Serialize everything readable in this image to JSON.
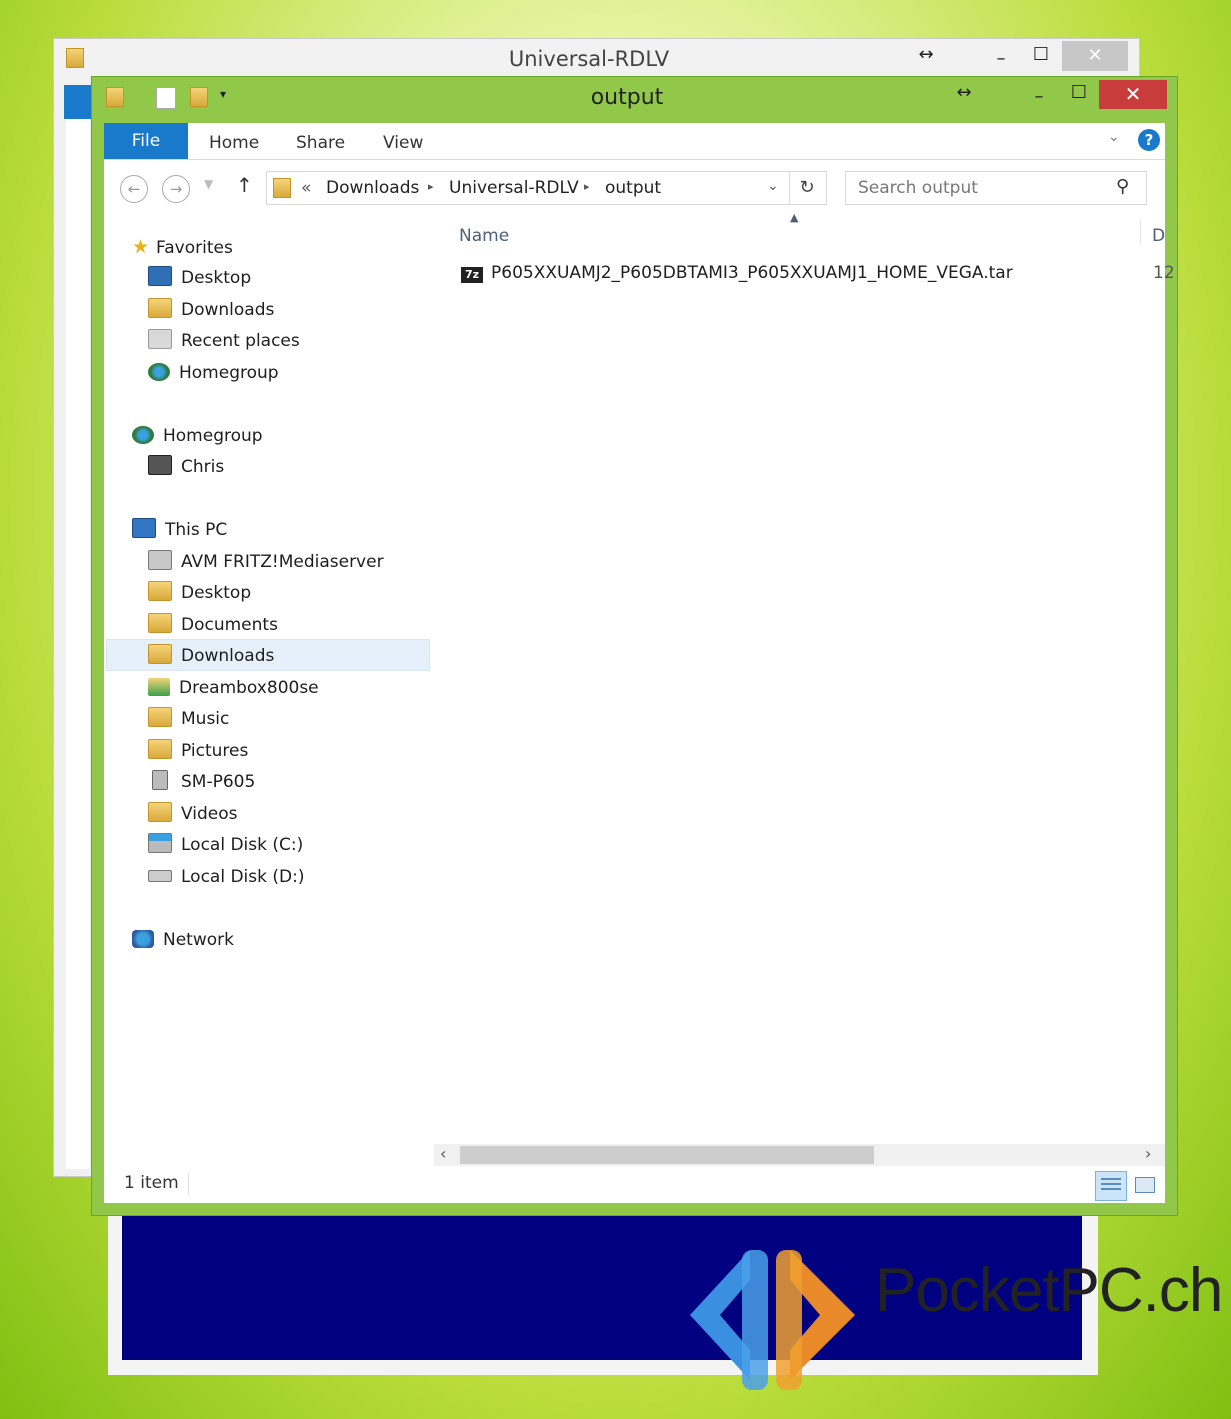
{
  "background_window": {
    "title": "Universal-RDLV"
  },
  "window": {
    "title": "output",
    "controls": {
      "resize": "↔",
      "minimize": "–",
      "maximize": "☐",
      "close": "✕"
    }
  },
  "ribbon": {
    "file": "File",
    "home": "Home",
    "share": "Share",
    "view": "View",
    "help": "?"
  },
  "address": {
    "overflow": "«",
    "crumbs": [
      "Downloads",
      "Universal-RDLV",
      "output"
    ]
  },
  "search": {
    "placeholder": "Search output"
  },
  "nav": {
    "favorites": {
      "label": "Favorites",
      "items": [
        "Desktop",
        "Downloads",
        "Recent places",
        "Homegroup"
      ]
    },
    "homegroup": {
      "label": "Homegroup",
      "items": [
        "Chris"
      ]
    },
    "this_pc": {
      "label": "This PC",
      "items": [
        "AVM FRITZ!Mediaserver",
        "Desktop",
        "Documents",
        "Downloads",
        "Dreambox800se",
        "Music",
        "Pictures",
        "SM-P605",
        "Videos",
        "Local Disk (C:)",
        "Local Disk (D:)"
      ]
    },
    "network": {
      "label": "Network"
    }
  },
  "columns": {
    "name": "Name",
    "date_partial": "D"
  },
  "files": [
    {
      "icon": "7z",
      "name": "P605XXUAMJ2_P605DBTAMI3_P605XXUAMJ1_HOME_VEGA.tar",
      "partial_meta": "12"
    }
  ],
  "status": {
    "count": "1 item"
  },
  "watermark": {
    "text": "PocketPC.ch"
  },
  "colors": {
    "accent": "#1979ca",
    "frame": "#91c84a",
    "close": "#c83c3c",
    "panel": "#000080"
  }
}
